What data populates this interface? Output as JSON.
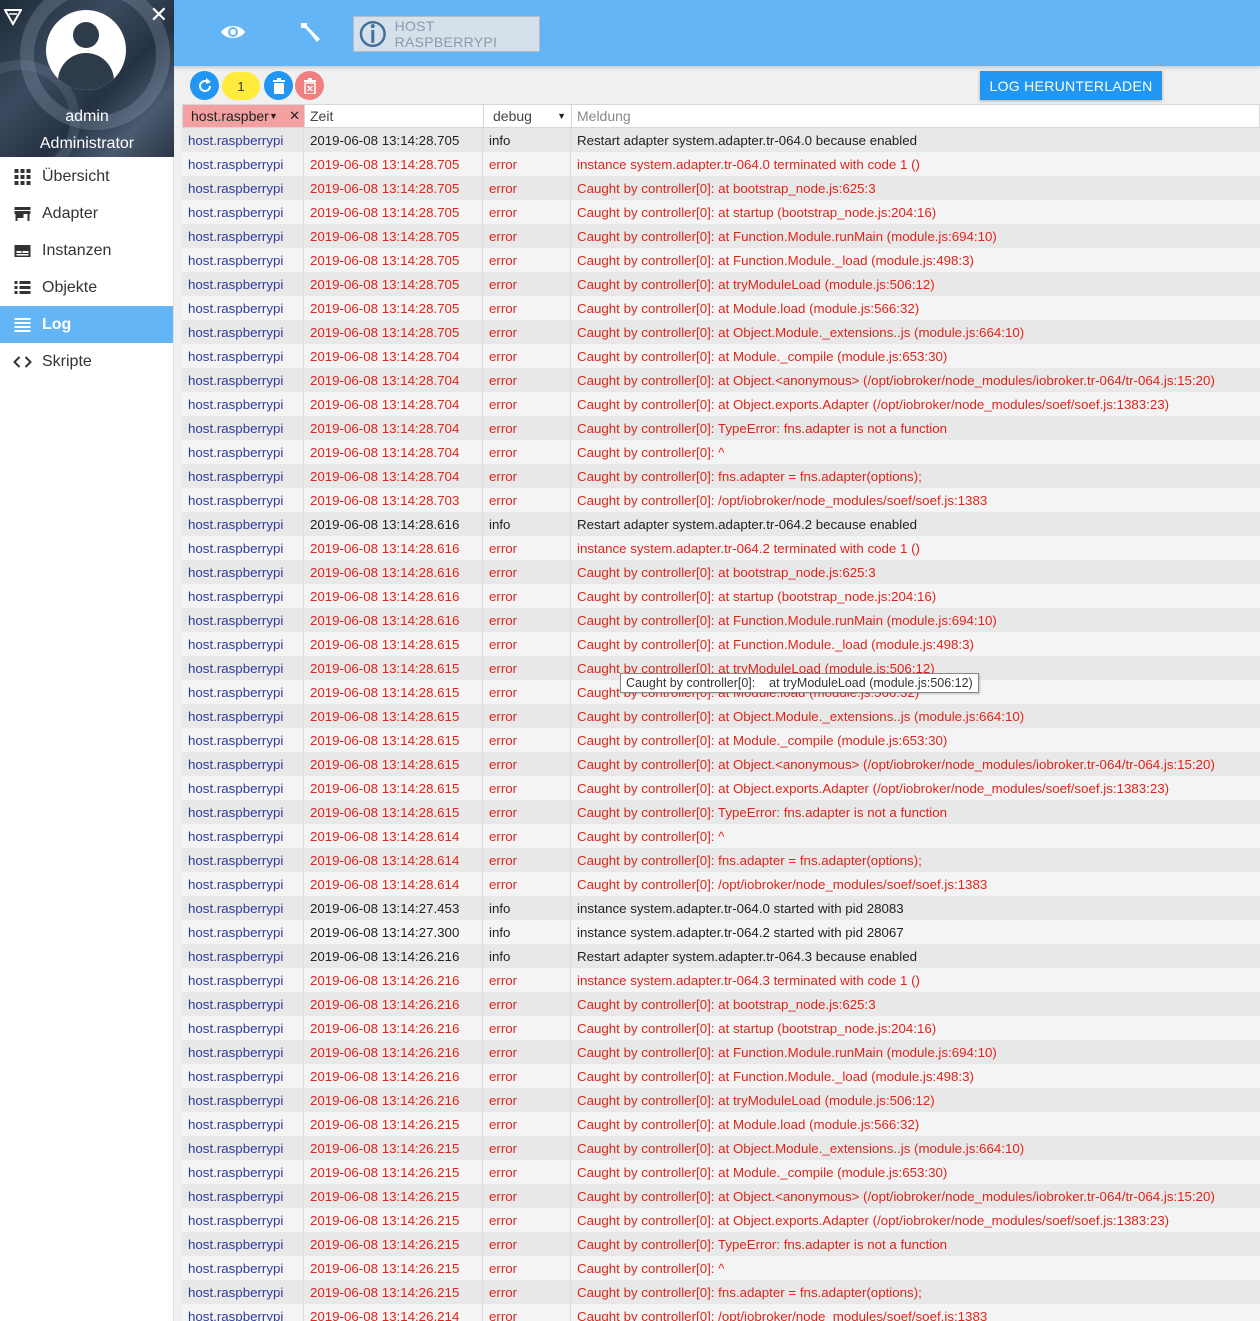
{
  "sidebar": {
    "user_name": "admin",
    "user_role": "Administrator",
    "items": [
      {
        "label": "Übersicht",
        "icon": "grid-icon"
      },
      {
        "label": "Adapter",
        "icon": "store-icon"
      },
      {
        "label": "Instanzen",
        "icon": "instances-icon"
      },
      {
        "label": "Objekte",
        "icon": "list-icon"
      },
      {
        "label": "Log",
        "icon": "log-icon",
        "active": true
      },
      {
        "label": "Skripte",
        "icon": "code-icon"
      }
    ]
  },
  "header": {
    "host_label": "HOST RASPBERRYPI",
    "icons": [
      "eye-icon",
      "wrench-icon",
      "iobroker-logo-icon"
    ]
  },
  "toolbar": {
    "count": "1",
    "download_label": "LOG HERUNTERLADEN"
  },
  "colors": {
    "accent": "#64b5f6",
    "error": "#e0241b",
    "source": "#2e3b9a",
    "badge": "#ffeb3b",
    "filter": "#f4a0a0"
  },
  "table": {
    "headers": {
      "source_filter": "host.raspber",
      "time": "Zeit",
      "severity_filter": "debug",
      "message_placeholder": "Meldung"
    },
    "rows": [
      [
        "host.raspberrypi",
        "2019-06-08 13:14:28.705",
        "info",
        "Restart adapter system.adapter.tr-064.0 because enabled"
      ],
      [
        "host.raspberrypi",
        "2019-06-08 13:14:28.705",
        "error",
        "instance system.adapter.tr-064.0 terminated with code 1 ()"
      ],
      [
        "host.raspberrypi",
        "2019-06-08 13:14:28.705",
        "error",
        "Caught by controller[0]: at bootstrap_node.js:625:3"
      ],
      [
        "host.raspberrypi",
        "2019-06-08 13:14:28.705",
        "error",
        "Caught by controller[0]: at startup (bootstrap_node.js:204:16)"
      ],
      [
        "host.raspberrypi",
        "2019-06-08 13:14:28.705",
        "error",
        "Caught by controller[0]: at Function.Module.runMain (module.js:694:10)"
      ],
      [
        "host.raspberrypi",
        "2019-06-08 13:14:28.705",
        "error",
        "Caught by controller[0]: at Function.Module._load (module.js:498:3)"
      ],
      [
        "host.raspberrypi",
        "2019-06-08 13:14:28.705",
        "error",
        "Caught by controller[0]: at tryModuleLoad (module.js:506:12)"
      ],
      [
        "host.raspberrypi",
        "2019-06-08 13:14:28.705",
        "error",
        "Caught by controller[0]: at Module.load (module.js:566:32)"
      ],
      [
        "host.raspberrypi",
        "2019-06-08 13:14:28.705",
        "error",
        "Caught by controller[0]: at Object.Module._extensions..js (module.js:664:10)"
      ],
      [
        "host.raspberrypi",
        "2019-06-08 13:14:28.704",
        "error",
        "Caught by controller[0]: at Module._compile (module.js:653:30)"
      ],
      [
        "host.raspberrypi",
        "2019-06-08 13:14:28.704",
        "error",
        "Caught by controller[0]: at Object.<anonymous> (/opt/iobroker/node_modules/iobroker.tr-064/tr-064.js:15:20)"
      ],
      [
        "host.raspberrypi",
        "2019-06-08 13:14:28.704",
        "error",
        "Caught by controller[0]: at Object.exports.Adapter (/opt/iobroker/node_modules/soef/soef.js:1383:23)"
      ],
      [
        "host.raspberrypi",
        "2019-06-08 13:14:28.704",
        "error",
        "Caught by controller[0]: TypeError: fns.adapter is not a function"
      ],
      [
        "host.raspberrypi",
        "2019-06-08 13:14:28.704",
        "error",
        "Caught by controller[0]: ^"
      ],
      [
        "host.raspberrypi",
        "2019-06-08 13:14:28.704",
        "error",
        "Caught by controller[0]: fns.adapter = fns.adapter(options);"
      ],
      [
        "host.raspberrypi",
        "2019-06-08 13:14:28.703",
        "error",
        "Caught by controller[0]: /opt/iobroker/node_modules/soef/soef.js:1383"
      ],
      [
        "host.raspberrypi",
        "2019-06-08 13:14:28.616",
        "info",
        "Restart adapter system.adapter.tr-064.2 because enabled"
      ],
      [
        "host.raspberrypi",
        "2019-06-08 13:14:28.616",
        "error",
        "instance system.adapter.tr-064.2 terminated with code 1 ()"
      ],
      [
        "host.raspberrypi",
        "2019-06-08 13:14:28.616",
        "error",
        "Caught by controller[0]: at bootstrap_node.js:625:3"
      ],
      [
        "host.raspberrypi",
        "2019-06-08 13:14:28.616",
        "error",
        "Caught by controller[0]: at startup (bootstrap_node.js:204:16)"
      ],
      [
        "host.raspberrypi",
        "2019-06-08 13:14:28.616",
        "error",
        "Caught by controller[0]: at Function.Module.runMain (module.js:694:10)"
      ],
      [
        "host.raspberrypi",
        "2019-06-08 13:14:28.615",
        "error",
        "Caught by controller[0]: at Function.Module._load (module.js:498:3)"
      ],
      [
        "host.raspberrypi",
        "2019-06-08 13:14:28.615",
        "error",
        "Caught by controller[0]: at tryModuleLoad (module.js:506:12)"
      ],
      [
        "host.raspberrypi",
        "2019-06-08 13:14:28.615",
        "error",
        "Caught by controller[0]: at Module.load (module.js:566:32)"
      ],
      [
        "host.raspberrypi",
        "2019-06-08 13:14:28.615",
        "error",
        "Caught by controller[0]: at Object.Module._extensions..js (module.js:664:10)"
      ],
      [
        "host.raspberrypi",
        "2019-06-08 13:14:28.615",
        "error",
        "Caught by controller[0]: at Module._compile (module.js:653:30)"
      ],
      [
        "host.raspberrypi",
        "2019-06-08 13:14:28.615",
        "error",
        "Caught by controller[0]: at Object.<anonymous> (/opt/iobroker/node_modules/iobroker.tr-064/tr-064.js:15:20)"
      ],
      [
        "host.raspberrypi",
        "2019-06-08 13:14:28.615",
        "error",
        "Caught by controller[0]: at Object.exports.Adapter (/opt/iobroker/node_modules/soef/soef.js:1383:23)"
      ],
      [
        "host.raspberrypi",
        "2019-06-08 13:14:28.615",
        "error",
        "Caught by controller[0]: TypeError: fns.adapter is not a function"
      ],
      [
        "host.raspberrypi",
        "2019-06-08 13:14:28.614",
        "error",
        "Caught by controller[0]: ^"
      ],
      [
        "host.raspberrypi",
        "2019-06-08 13:14:28.614",
        "error",
        "Caught by controller[0]: fns.adapter = fns.adapter(options);"
      ],
      [
        "host.raspberrypi",
        "2019-06-08 13:14:28.614",
        "error",
        "Caught by controller[0]: /opt/iobroker/node_modules/soef/soef.js:1383"
      ],
      [
        "host.raspberrypi",
        "2019-06-08 13:14:27.453",
        "info",
        "instance system.adapter.tr-064.0 started with pid 28083"
      ],
      [
        "host.raspberrypi",
        "2019-06-08 13:14:27.300",
        "info",
        "instance system.adapter.tr-064.2 started with pid 28067"
      ],
      [
        "host.raspberrypi",
        "2019-06-08 13:14:26.216",
        "info",
        "Restart adapter system.adapter.tr-064.3 because enabled"
      ],
      [
        "host.raspberrypi",
        "2019-06-08 13:14:26.216",
        "error",
        "instance system.adapter.tr-064.3 terminated with code 1 ()"
      ],
      [
        "host.raspberrypi",
        "2019-06-08 13:14:26.216",
        "error",
        "Caught by controller[0]: at bootstrap_node.js:625:3"
      ],
      [
        "host.raspberrypi",
        "2019-06-08 13:14:26.216",
        "error",
        "Caught by controller[0]: at startup (bootstrap_node.js:204:16)"
      ],
      [
        "host.raspberrypi",
        "2019-06-08 13:14:26.216",
        "error",
        "Caught by controller[0]: at Function.Module.runMain (module.js:694:10)"
      ],
      [
        "host.raspberrypi",
        "2019-06-08 13:14:26.216",
        "error",
        "Caught by controller[0]: at Function.Module._load (module.js:498:3)"
      ],
      [
        "host.raspberrypi",
        "2019-06-08 13:14:26.216",
        "error",
        "Caught by controller[0]: at tryModuleLoad (module.js:506:12)"
      ],
      [
        "host.raspberrypi",
        "2019-06-08 13:14:26.215",
        "error",
        "Caught by controller[0]: at Module.load (module.js:566:32)"
      ],
      [
        "host.raspberrypi",
        "2019-06-08 13:14:26.215",
        "error",
        "Caught by controller[0]: at Object.Module._extensions..js (module.js:664:10)"
      ],
      [
        "host.raspberrypi",
        "2019-06-08 13:14:26.215",
        "error",
        "Caught by controller[0]: at Module._compile (module.js:653:30)"
      ],
      [
        "host.raspberrypi",
        "2019-06-08 13:14:26.215",
        "error",
        "Caught by controller[0]: at Object.<anonymous> (/opt/iobroker/node_modules/iobroker.tr-064/tr-064.js:15:20)"
      ],
      [
        "host.raspberrypi",
        "2019-06-08 13:14:26.215",
        "error",
        "Caught by controller[0]: at Object.exports.Adapter (/opt/iobroker/node_modules/soef/soef.js:1383:23)"
      ],
      [
        "host.raspberrypi",
        "2019-06-08 13:14:26.215",
        "error",
        "Caught by controller[0]: TypeError: fns.adapter is not a function"
      ],
      [
        "host.raspberrypi",
        "2019-06-08 13:14:26.215",
        "error",
        "Caught by controller[0]: ^"
      ],
      [
        "host.raspberrypi",
        "2019-06-08 13:14:26.215",
        "error",
        "Caught by controller[0]: fns.adapter = fns.adapter(options);"
      ],
      [
        "host.raspberrypi",
        "2019-06-08 13:14:26.214",
        "error",
        "Caught by controller[0]: /opt/iobroker/node_modules/soef/soef.js:1383"
      ]
    ]
  },
  "tooltip": "Caught by controller[0]:    at tryModuleLoad (module.js:506:12)"
}
